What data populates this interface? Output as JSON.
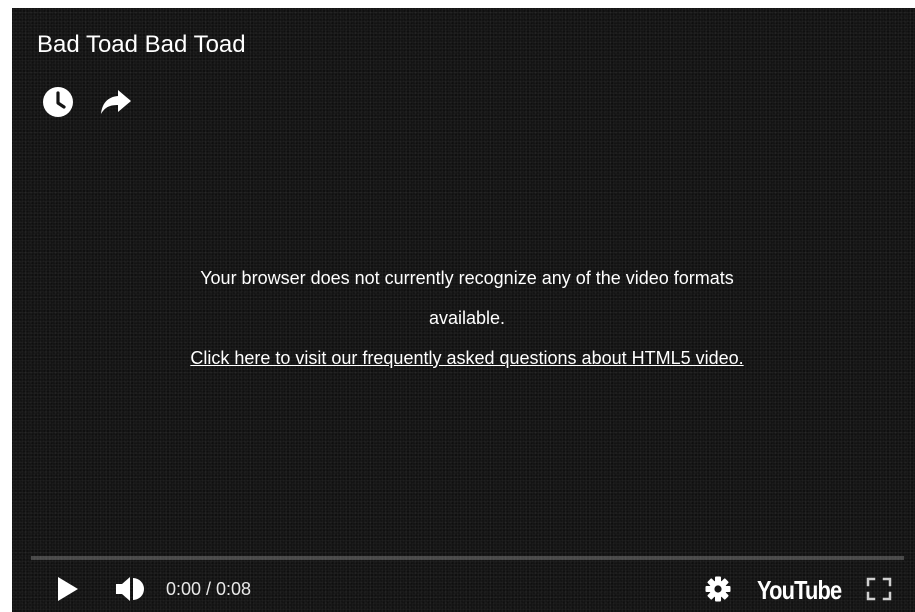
{
  "video": {
    "title": "Bad Toad Bad Toad"
  },
  "top_actions": {
    "watch_later_icon": "clock-icon",
    "share_icon": "share-arrow-icon"
  },
  "error": {
    "line1": "Your browser does not currently recognize any of the video formats",
    "line2": "available.",
    "faq_link": "Click here to visit our frequently asked questions about HTML5 video."
  },
  "controls": {
    "progress_fraction": 0,
    "time": "0:00 / 0:08",
    "play_icon": "play-icon",
    "volume_icon": "volume-icon",
    "settings_icon": "gear-icon",
    "logo": "YouTube",
    "fullscreen_icon": "fullscreen-icon"
  },
  "colors": {
    "background": "#141414",
    "text": "#ffffff",
    "progress_track": "#3a3a3a"
  }
}
